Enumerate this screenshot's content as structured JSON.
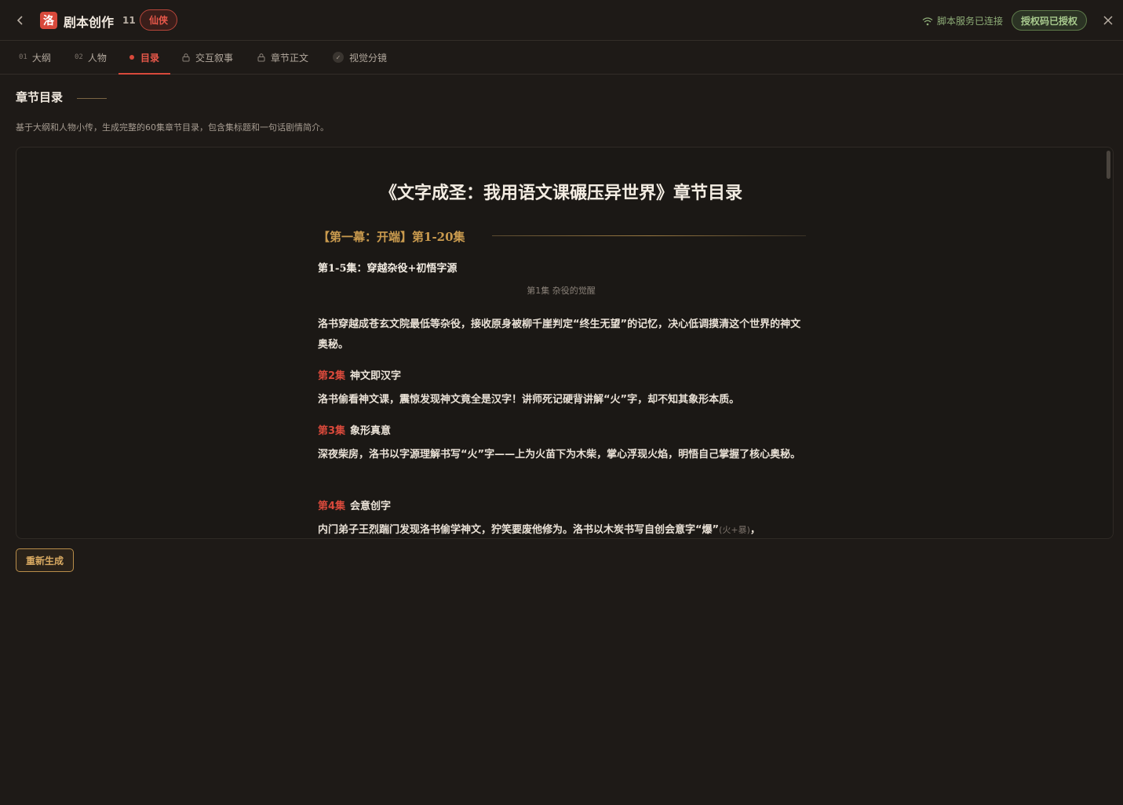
{
  "header": {
    "logo_char": "洛",
    "title": "剧本创作",
    "count": "11",
    "genre": "仙侠",
    "connection_status": "脚本服务已连接",
    "auth_status": "授权码已授权"
  },
  "tabs": [
    {
      "num": "01",
      "label": "大纲"
    },
    {
      "num": "02",
      "label": "人物"
    },
    {
      "label": "目录"
    },
    {
      "label": "交互叙事"
    },
    {
      "label": "章节正文"
    },
    {
      "label": "视觉分镜"
    }
  ],
  "section": {
    "title": "章节目录",
    "description": "基于大纲和人物小传，生成完整的60集章节目录，包含集标题和一句话剧情简介。"
  },
  "document": {
    "title": "《文字成圣：我用语文课碾压异世界》章节目录",
    "act": "【第一幕：开端】第1-20集",
    "group": "第1-5集：穿越杂役+初悟字源",
    "ep1_heading": "第1集  杂役的觉醒",
    "ep1_text": "洛书穿越成苍玄文院最低等杂役，接收原身被柳千崖判定“终生无望”的记忆，决心低调摸清这个世界的神文奥秘。",
    "episodes": [
      {
        "no": "第2集",
        "title": "神文即汉字",
        "text": "洛书偷看神文课，震惊发现神文竟全是汉字！讲师死记硬背讲解“火”字，却不知其象形本质。"
      },
      {
        "no": "第3集",
        "title": "象形真意",
        "text": "深夜柴房，洛书以字源理解书写“火”字——上为火苗下为木柴，掌心浮现火焰，明悟自己掌握了核心奥秘。"
      },
      {
        "no": "第4集",
        "title": "会意创字",
        "text": "内门弟子王烈踹门发现洛书偷学神文，狞笑要废他修为。洛书以木炭书写自创会意字“爆”",
        "note": "(火+暴)",
        "tail": "，"
      }
    ]
  },
  "actions": {
    "regenerate": "重新生成"
  }
}
